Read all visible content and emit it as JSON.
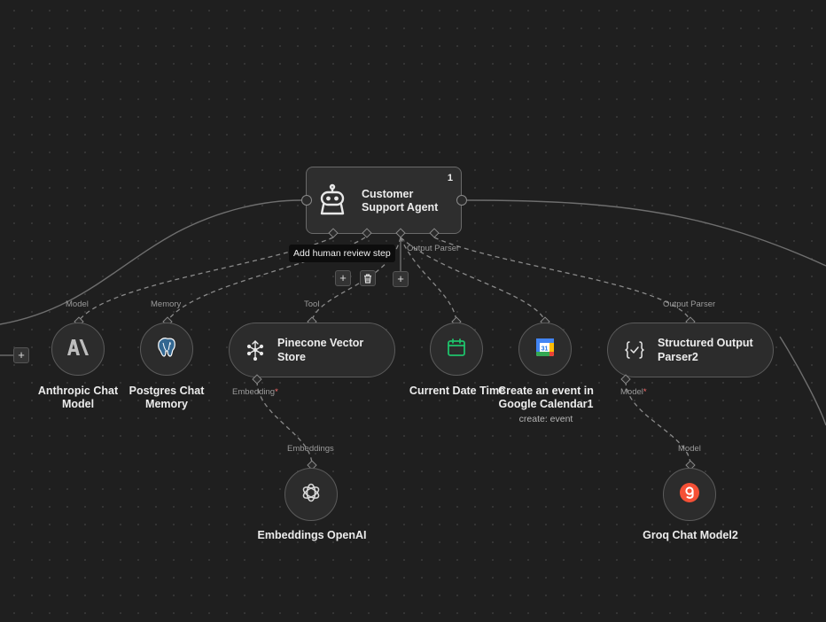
{
  "agent": {
    "title_line1": "Customer",
    "title_line2": "Support Agent",
    "badge": "1",
    "tooltip": "Add human review step",
    "port_labels": {
      "output_parser": "Output Parser"
    }
  },
  "buttons": {
    "add": "+",
    "delete": "🗑"
  },
  "nodes": {
    "anthropic": {
      "title": "Anthropic Chat Model",
      "port_label": "Model"
    },
    "postgres": {
      "title": "Postgres Chat Memory",
      "port_label": "Memory"
    },
    "pinecone": {
      "title": "Pinecone Vector Store",
      "port_label": "Tool",
      "bottom_label": "Embedding",
      "required": "*"
    },
    "datetime": {
      "title": "Current Date Time"
    },
    "gcal": {
      "title": "Create an event in Google Calendar1",
      "subtitle": "create: event"
    },
    "structured": {
      "title": "Structured Output Parser2",
      "port_label": "Output Parser",
      "bottom_label": "Model",
      "required": "*"
    },
    "openai": {
      "title": "Embeddings OpenAI",
      "port_label": "Embeddings"
    },
    "groq": {
      "title": "Groq Chat Model2",
      "port_label": "Model"
    }
  },
  "icons": {
    "agent": "robot-icon",
    "anthropic": "anthropic-logo-icon",
    "postgres": "postgres-elephant-icon",
    "pinecone": "pinecone-icon",
    "datetime": "calendar-icon",
    "gcal": "google-calendar-icon",
    "structured": "code-braces-check-icon",
    "openai": "openai-logo-icon",
    "groq": "groq-logo-icon"
  },
  "colors": {
    "canvas": "#1f1f1f",
    "node_bg": "#2c2c2c",
    "calendar_green": "#1ec26b",
    "groq_red": "#f55036",
    "required": "#ff6d6d"
  }
}
